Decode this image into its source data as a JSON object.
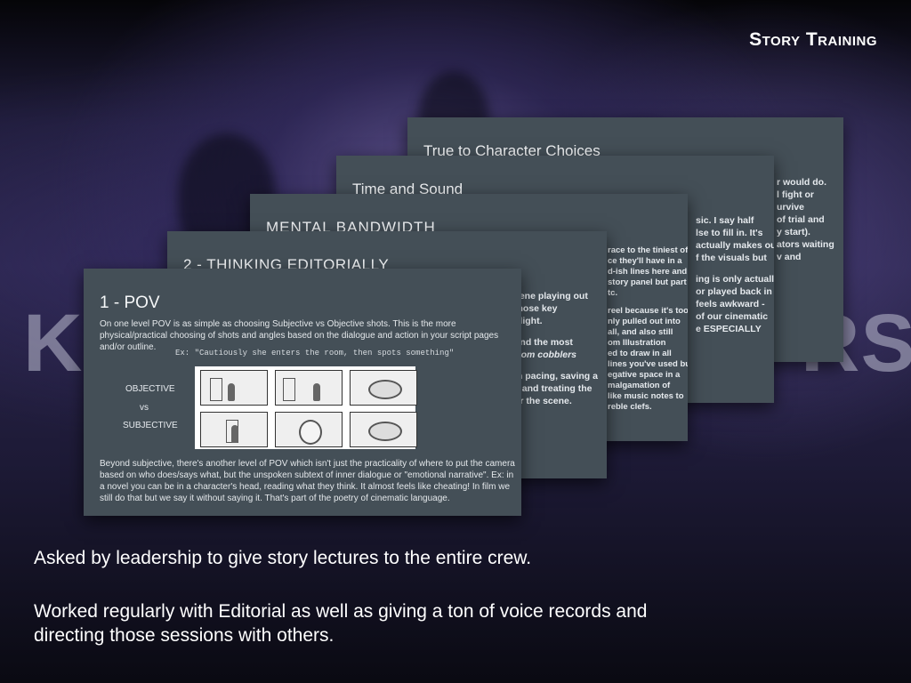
{
  "header": {
    "title": "Story Training"
  },
  "background": {
    "text_left": "K-",
    "text_right": "RS"
  },
  "slides": {
    "s5": {
      "title": "True to Character Choices",
      "lines": [
        "r would do.",
        "l fight or",
        "urvive",
        "of trial and",
        "y start).",
        "ators waiting",
        "v and"
      ]
    },
    "s4": {
      "title": "Time and Sound",
      "lines": [
        "sic. I say half",
        "lse to fill in. It's",
        "actually makes our",
        "f the visuals but",
        "",
        "ing is only actually",
        "or played back in",
        "feels awkward -",
        "of our cinematic",
        "e ESPECIALLY"
      ]
    },
    "s3": {
      "title": "MENTAL BANDWIDTH",
      "lines": [
        "race to the tiniest of",
        "ce they'll have in a",
        "d-ish lines here and",
        "story panel but part",
        "tc.",
        "",
        "reel because it's too",
        "nly pulled out into",
        "all, and also still",
        "om Illustration",
        "ed to draw in all",
        "lines you've used but",
        "egative space in a",
        "malgamation of",
        "like music notes to",
        "reble clefs."
      ]
    },
    "s2": {
      "title": "2 - THINKING EDITORIALLY",
      "lines": [
        "cene playing out",
        "those key",
        "hlight.",
        "",
        "find the most",
        "from cobblers",
        "",
        "in pacing, saving a",
        "s and treating the",
        "or the scene."
      ]
    },
    "s1": {
      "title": "1 - POV",
      "intro": "On one level POV is as simple as choosing Subjective vs Objective shots. This is the more physical/practical choosing of shots and angles based on the dialogue and action in your script pages and/or outline.",
      "example": "Ex: \"Cautiously she enters the room, then spots something\"",
      "label_objective": "OBJECTIVE",
      "label_vs": "vs",
      "label_subjective": "SUBJECTIVE",
      "outro": "Beyond subjective, there's another level of POV which isn't just the practicality of where to put the camera based on who does/says what, but the unspoken subtext of inner dialogue or \"emotional narrative\". Ex: in a novel you can be in a character's head, reading what they think. It almost feels like cheating! In film we still do that but we say it without saying it. That's part of the poetry of cinematic language."
    }
  },
  "captions": {
    "line1": "Asked by leadership to give story lectures to the entire crew.",
    "line2": "Worked regularly with Editorial as well as giving a ton of voice records and",
    "line3": "directing those sessions with others."
  }
}
